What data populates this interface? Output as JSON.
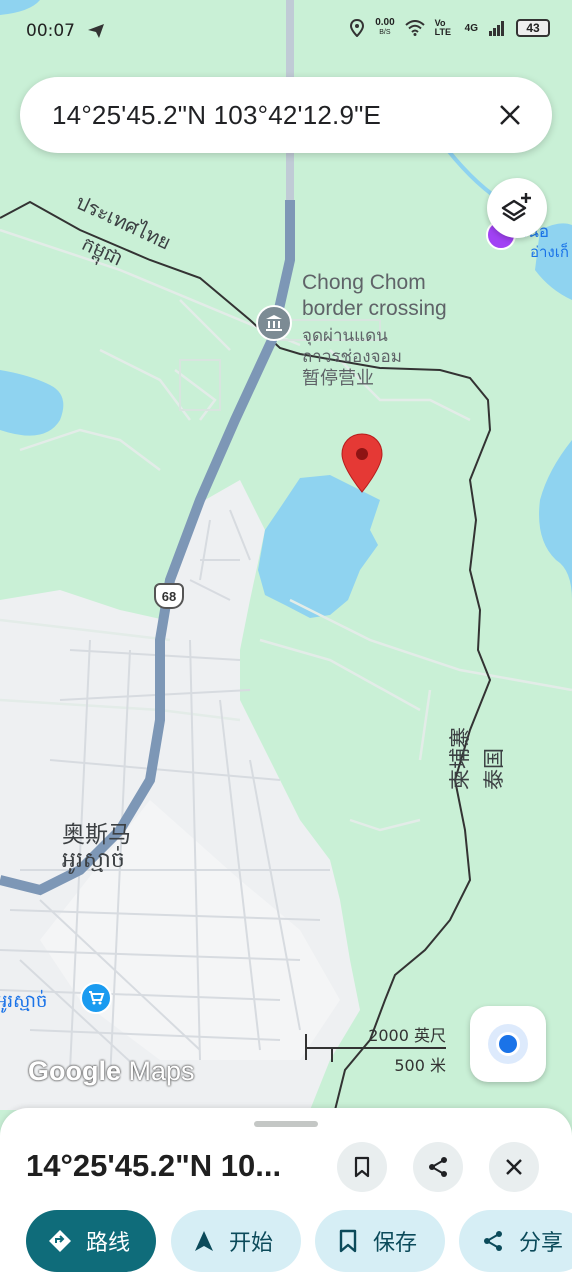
{
  "status_bar": {
    "time": "00:07",
    "net_speed": "0.00",
    "net_unit": "B/S",
    "volte": "Vo LTE",
    "network": "4G",
    "battery": "43"
  },
  "search": {
    "query": "14°25'45.2\"N 103°42'12.9\"E"
  },
  "map": {
    "labels": {
      "thailand_thai": "ประเทศไทย",
      "cambodia_khmer": "កម្ពុជា",
      "chong_chom_en_1": "Chong Chom",
      "chong_chom_en_2": "border crossing",
      "chong_chom_thai": "จุดผ่านแดน",
      "chong_chom_thai_2": "ถาวรช่องจอม",
      "temporarily_closed": "暂停营业",
      "route_shield": "68",
      "osmach_zh": "奥斯马",
      "osmach_km": "អូរស្មាច់",
      "osmach_km_shop": "អូរស្មាច់",
      "cambodia_zh": "柬埔寨",
      "thailand_zh": "泰国",
      "lake_thai_1": "หนอ",
      "lake_thai_2": "อ่างเก็"
    },
    "scale": {
      "feet": "2000 英尺",
      "meters": "500 米"
    },
    "attribution": {
      "google": "Google",
      "maps": "Maps"
    }
  },
  "sheet": {
    "title": "14°25'45.2\"N 10...",
    "chips": [
      {
        "label": "路线",
        "icon": "directions-icon"
      },
      {
        "label": "开始",
        "icon": "navigation-arrow-icon"
      },
      {
        "label": "保存",
        "icon": "bookmark-icon"
      },
      {
        "label": "分享",
        "icon": "share-icon"
      }
    ]
  },
  "colors": {
    "map_green": "#c9f0d6",
    "water": "#8fd3f0",
    "urban": "#eef0f2",
    "highway": "#7d97b6",
    "pin_red": "#e53935",
    "primary_chip": "#0f6c7a",
    "secondary_chip": "#d6eef5"
  }
}
